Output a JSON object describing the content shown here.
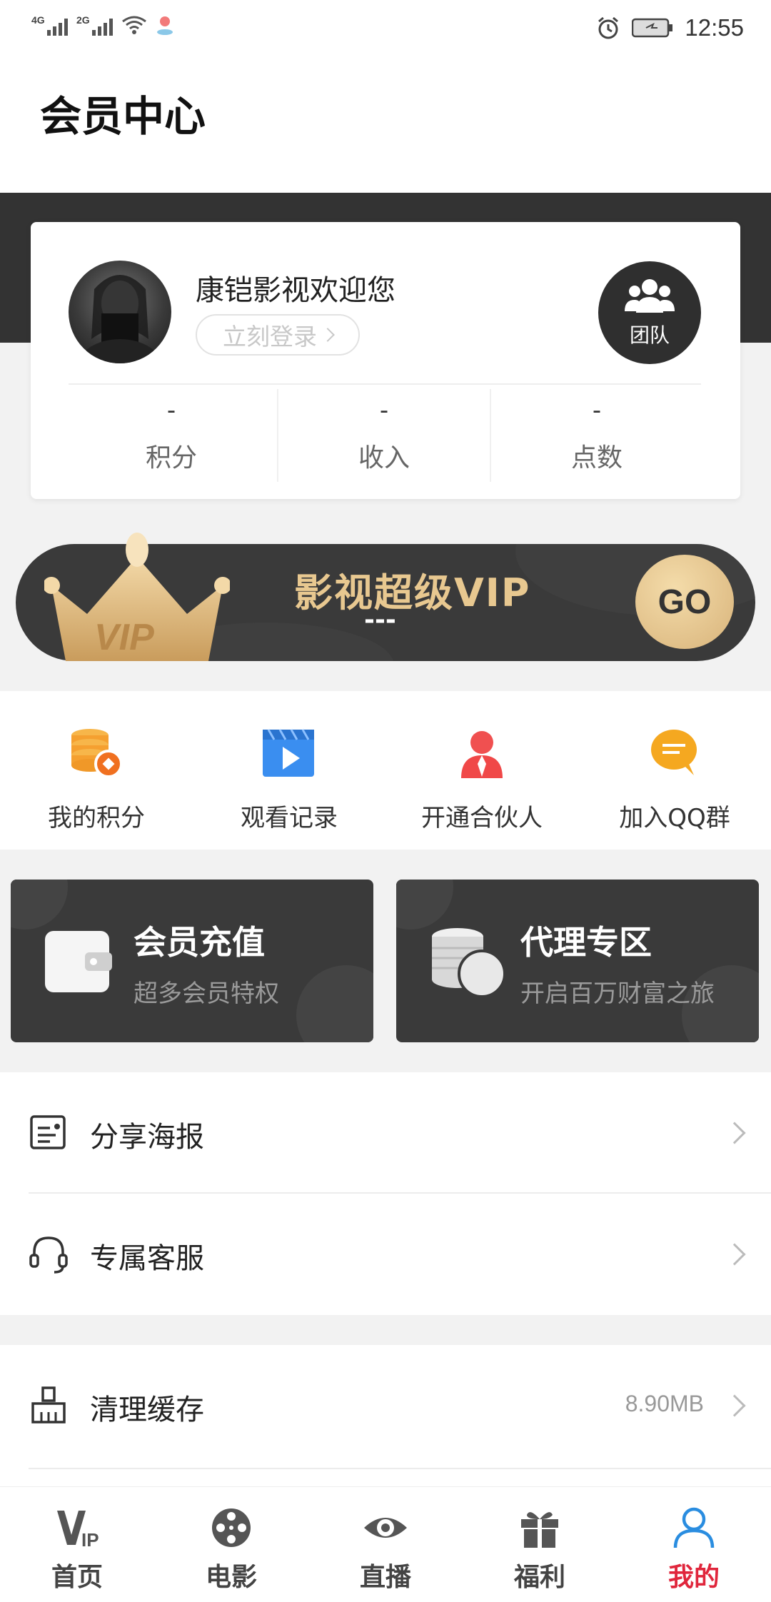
{
  "status_bar": {
    "network_1": "4G",
    "network_2": "2G",
    "time": "12:55"
  },
  "header": {
    "title": "会员中心"
  },
  "profile": {
    "welcome": "康铠影视欢迎您",
    "login_button": "立刻登录",
    "team_label": "团队",
    "stats": [
      {
        "value": "-",
        "label": "积分"
      },
      {
        "value": "-",
        "label": "收入"
      },
      {
        "value": "-",
        "label": "点数"
      }
    ]
  },
  "vip_banner": {
    "badge": "VIP",
    "title": "影视超级VIP",
    "subtitle": "---",
    "go_label": "GO"
  },
  "quick_actions": [
    {
      "label": "我的积分",
      "icon": "coins-icon",
      "color": "#f5a030"
    },
    {
      "label": "观看记录",
      "icon": "play-video-icon",
      "color": "#3a8ef0"
    },
    {
      "label": "开通合伙人",
      "icon": "partner-icon",
      "color": "#f04848"
    },
    {
      "label": "加入QQ群",
      "icon": "chat-bubble-icon",
      "color": "#f5a820"
    }
  ],
  "promo_cards": [
    {
      "title": "会员充值",
      "subtitle": "超多会员特权",
      "icon": "wallet-icon"
    },
    {
      "title": "代理专区",
      "subtitle": "开启百万财富之旅",
      "icon": "yuan-coins-icon"
    }
  ],
  "menu": [
    {
      "label": "分享海报",
      "icon": "poster-icon",
      "value": ""
    },
    {
      "label": "专属客服",
      "icon": "headset-icon",
      "value": ""
    },
    {
      "label": "清理缓存",
      "icon": "broom-icon",
      "value": "8.90MB"
    }
  ],
  "bottom_nav": [
    {
      "label": "首页",
      "icon": "vip-home-icon",
      "active": false
    },
    {
      "label": "电影",
      "icon": "film-reel-icon",
      "active": false
    },
    {
      "label": "直播",
      "icon": "eye-icon",
      "active": false
    },
    {
      "label": "福利",
      "icon": "gift-icon",
      "active": false
    },
    {
      "label": "我的",
      "icon": "user-icon",
      "active": true
    }
  ],
  "colors": {
    "accent_red": "#e0263c",
    "active_blue": "#2a8de0",
    "vip_gold": "#e8c890",
    "dark": "#3a3a3a"
  }
}
